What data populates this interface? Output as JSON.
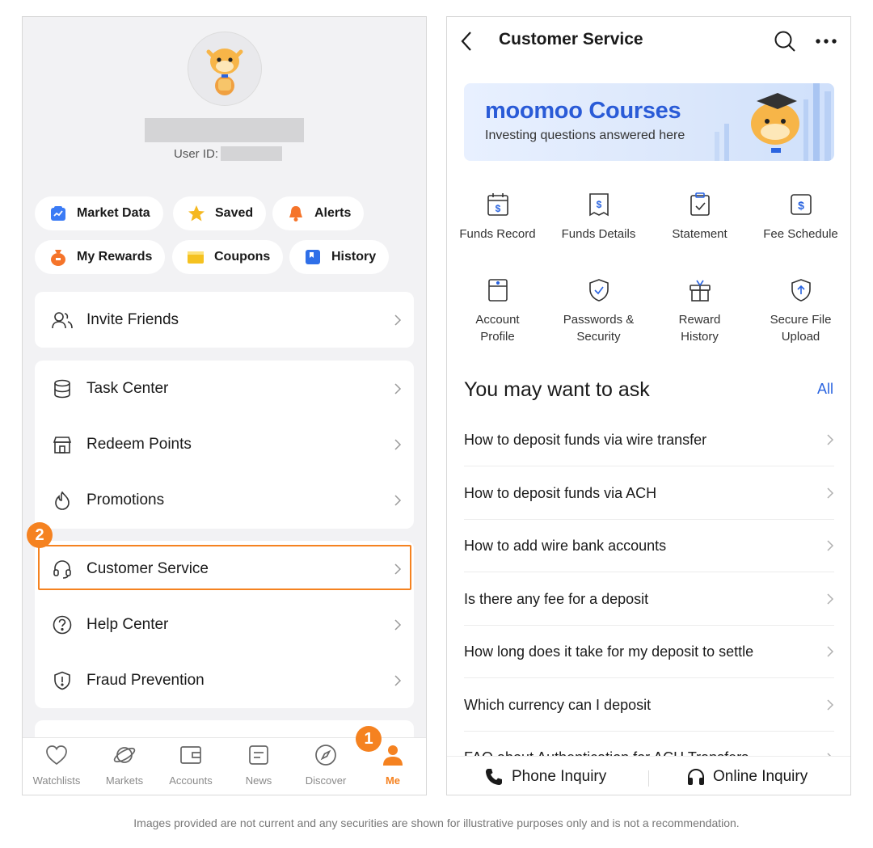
{
  "profile": {
    "user_id_label": "User ID:"
  },
  "chips": [
    {
      "label": "Market Data",
      "icon": "market-data-icon"
    },
    {
      "label": "Saved",
      "icon": "star-icon"
    },
    {
      "label": "Alerts",
      "icon": "bell-icon"
    },
    {
      "label": "My Rewards",
      "icon": "reward-bag-icon"
    },
    {
      "label": "Coupons",
      "icon": "coupon-icon"
    },
    {
      "label": "History",
      "icon": "history-icon"
    }
  ],
  "menu": {
    "invite": "Invite Friends",
    "task_center": "Task Center",
    "redeem_points": "Redeem Points",
    "promotions": "Promotions",
    "customer_service": "Customer Service",
    "help_center": "Help Center",
    "fraud_prevention": "Fraud Prevention"
  },
  "badges": {
    "step1": "1",
    "step2": "2"
  },
  "tabs": [
    {
      "label": "Watchlists",
      "icon": "heart-icon"
    },
    {
      "label": "Markets",
      "icon": "planet-icon"
    },
    {
      "label": "Accounts",
      "icon": "wallet-icon"
    },
    {
      "label": "News",
      "icon": "news-icon"
    },
    {
      "label": "Discover",
      "icon": "compass-icon"
    },
    {
      "label": "Me",
      "icon": "person-icon",
      "active": true
    }
  ],
  "colors": {
    "accent": "#f58220",
    "link": "#2a64e0",
    "banner_title": "#2a5bd7"
  },
  "cs": {
    "title": "Customer Service",
    "banner_title": "moomoo Courses",
    "banner_sub": "Investing questions answered here",
    "grid": [
      {
        "label": "Funds Record",
        "icon": "calendar-dollar-icon"
      },
      {
        "label": "Funds Details",
        "icon": "document-dollar-icon"
      },
      {
        "label": "Statement",
        "icon": "clipboard-check-icon"
      },
      {
        "label": "Fee Schedule",
        "icon": "dollar-square-icon"
      },
      {
        "label": "Account\nProfile",
        "icon": "profile-card-icon"
      },
      {
        "label": "Passwords &\nSecurity",
        "icon": "shield-check-icon"
      },
      {
        "label": "Reward\nHistory",
        "icon": "gift-icon"
      },
      {
        "label": "Secure File\nUpload",
        "icon": "shield-upload-icon"
      }
    ],
    "ask_title": "You may want to ask",
    "ask_all": "All",
    "questions": [
      "How to deposit funds via wire transfer",
      "How to deposit funds via ACH",
      "How to add wire bank accounts",
      "Is there any fee for a deposit",
      "How long does it take for my deposit to settle",
      "Which currency can I deposit",
      "FAQ about Authentication for ACH Transfers"
    ],
    "phone_inquiry": "Phone Inquiry",
    "online_inquiry": "Online Inquiry"
  },
  "disclaimer": "Images provided are not current and any securities are shown for illustrative purposes only and is not a recommendation."
}
